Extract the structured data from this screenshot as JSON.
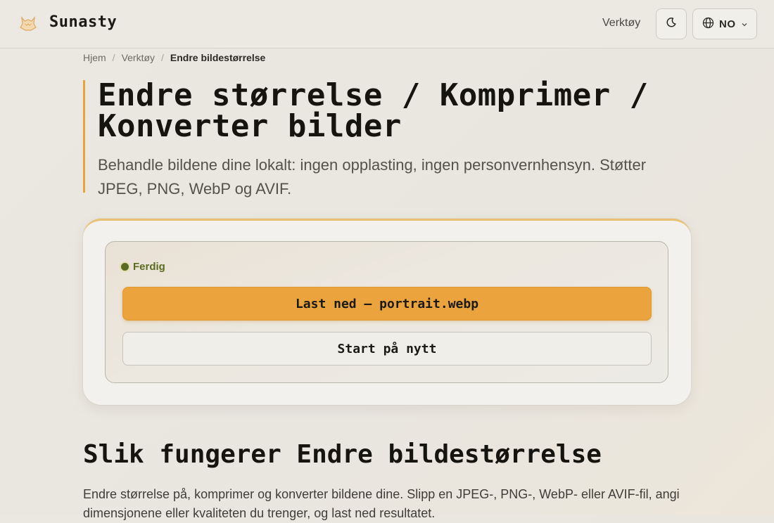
{
  "header": {
    "brand": "Sunasty",
    "nav_tools": "Verktøy",
    "language": "NO",
    "icons": {
      "logo": "fox-logo-icon",
      "theme": "moon-icon",
      "globe": "globe-icon",
      "chevron": "chevron-down-icon"
    }
  },
  "breadcrumb": {
    "home": "Hjem",
    "tools": "Verktøy",
    "current": "Endre bildestørrelse"
  },
  "hero": {
    "title": "Endre størrelse / Komprimer / Konverter bilder",
    "subtitle": "Behandle bildene dine lokalt: ingen opplasting, ingen personvernhensyn. Støtter JPEG, PNG, WebP og AVIF."
  },
  "result": {
    "status": "Ferdig",
    "download_label": "Last ned — portrait.webp",
    "restart_label": "Start på nytt"
  },
  "section": {
    "title": "Slik fungerer Endre bildestørrelse",
    "body": "Endre størrelse på, komprimer og konverter bildene dine. Slipp en JPEG-, PNG-, WebP- eller AVIF-fil, angi dimensjonene eller kvaliteten du trenger, og last ned resultatet."
  },
  "colors": {
    "accent": "#eaa33d",
    "status_ok": "#5b6b1f",
    "accent_border": "#e8a33c"
  }
}
